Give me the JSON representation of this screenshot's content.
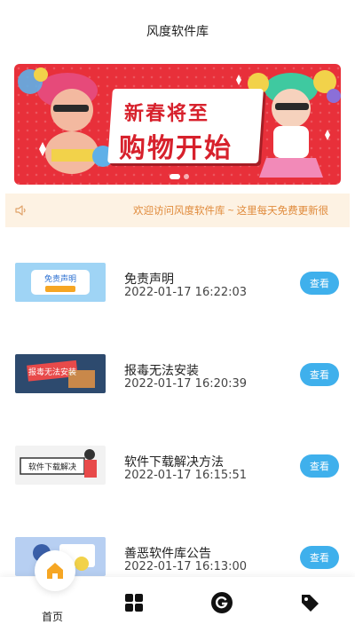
{
  "header": {
    "title": "风度软件库"
  },
  "banner": {
    "line1": "新春将至",
    "line2": "购物开始"
  },
  "notice": {
    "text": "欢迎访问风度软件库 ~ 这里每天免费更新很"
  },
  "items": [
    {
      "title": "免责声明",
      "date": "2022-01-17 16:22:03",
      "button": "查看",
      "thumb_text": "免责声明",
      "thumb_color": "#9fd4f5"
    },
    {
      "title": "报毒无法安装",
      "date": "2022-01-17 16:20:39",
      "button": "查看",
      "thumb_text": "报毒无法安装",
      "thumb_color": "#2d4a6e"
    },
    {
      "title": "软件下载解决方法",
      "date": "2022-01-17 16:15:51",
      "button": "查看",
      "thumb_text": "软件下载解决",
      "thumb_color": "#f2f2f2"
    },
    {
      "title": "善恶软件库公告",
      "date": "2022-01-17 16:13:00",
      "button": "查看",
      "thumb_text": "",
      "thumb_color": "#b7cff2"
    }
  ],
  "tabbar": {
    "home_label": "首页",
    "icons": [
      "home-icon",
      "grid-icon",
      "g-circle-icon",
      "tag-icon"
    ]
  },
  "colors": {
    "accent": "#3fb0ec",
    "banner_red": "#e8303a",
    "notice_text": "#e08a3a",
    "home_orange": "#f6a623"
  }
}
